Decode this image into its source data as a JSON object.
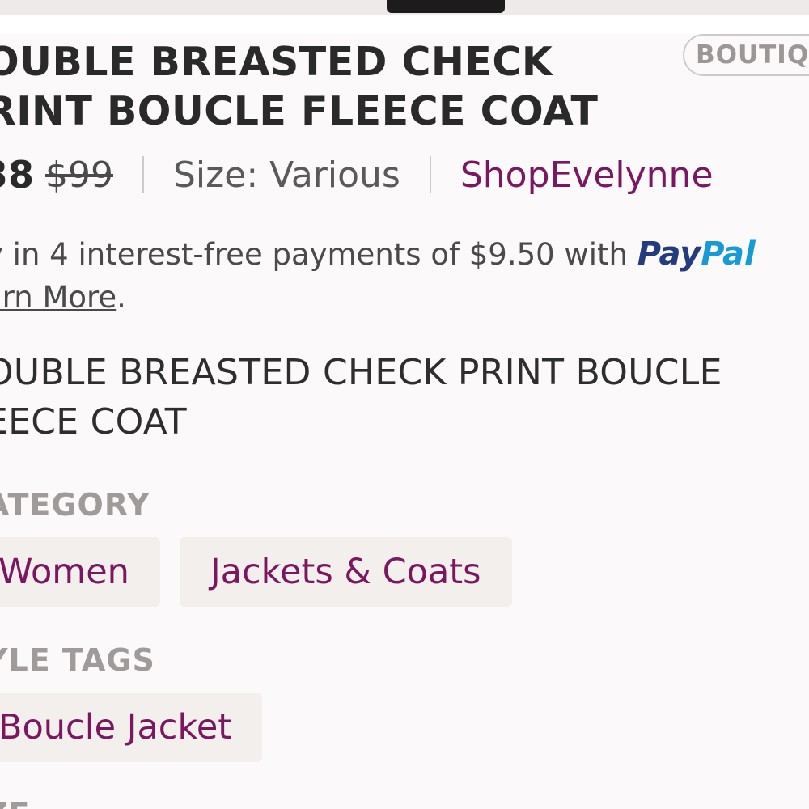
{
  "product": {
    "title_line1": "OUBLE BREASTED CHECK",
    "title_line2": "RINT BOUCLE FLEECE COAT",
    "badge": "BOUTIQUE",
    "price_now": "38",
    "price_was": "$99",
    "size": "Size: Various",
    "seller": "ShopEvelynne"
  },
  "paypal": {
    "text": "y in 4 interest-free payments of $9.50 with ",
    "logo_pay": "Pay",
    "logo_pal": "Pal",
    "learn_more": "arn More",
    "period": "."
  },
  "description": {
    "line1": "OUBLE BREASTED CHECK PRINT BOUCLE",
    "line2": "EECE COAT"
  },
  "category": {
    "label": "ATEGORY",
    "chips": [
      "Women",
      "Jackets & Coats"
    ]
  },
  "style_tags": {
    "label": "YLE TAGS",
    "chips": [
      "Boucle Jacket"
    ]
  },
  "next_section": {
    "label": "ZE"
  },
  "colors": {
    "accent": "#7b1761",
    "paypal_dark": "#253b80",
    "paypal_light": "#179bd7",
    "chip_bg": "#f2efec"
  }
}
